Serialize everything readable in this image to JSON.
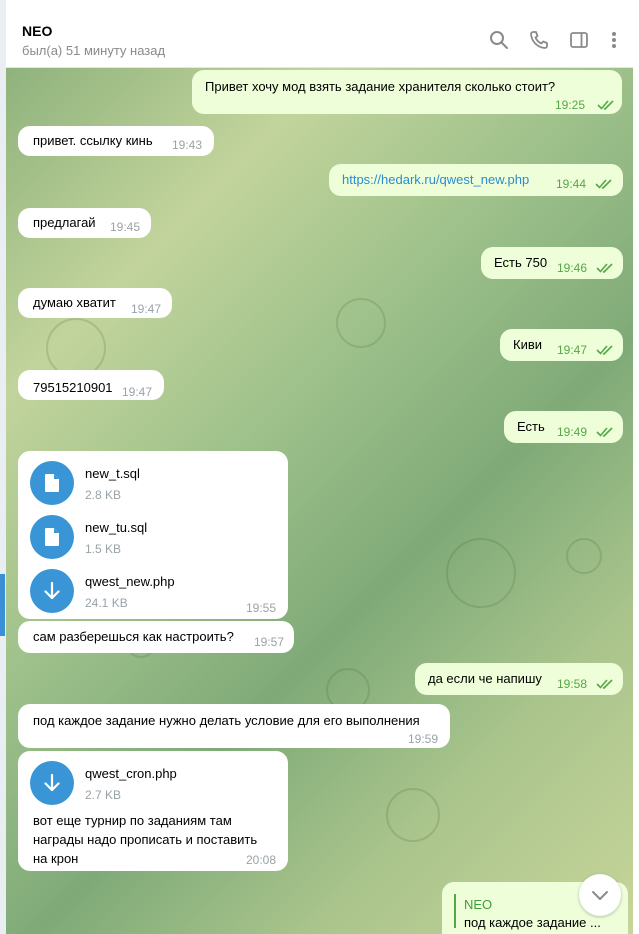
{
  "header": {
    "name": "NEO",
    "status": "был(а) 51 минуту назад",
    "icons": [
      "search-icon",
      "phone-icon",
      "sidebar-toggle-icon",
      "more-vertical-icon"
    ]
  },
  "messages": [
    {
      "dir": "out",
      "text": "Привет хочу мод взять задание хранителя сколько стоит?",
      "time": "19:25"
    },
    {
      "dir": "in",
      "text": "привет. ссылку кинь",
      "time": "19:43"
    },
    {
      "dir": "out",
      "text": "https://hedark.ru/qwest_new.php",
      "time": "19:44"
    },
    {
      "dir": "in",
      "text": "предлагай",
      "time": "19:45"
    },
    {
      "dir": "out",
      "text": "Есть 750",
      "time": "19:46"
    },
    {
      "dir": "in",
      "text": "думаю хватит",
      "time": "19:47"
    },
    {
      "dir": "out",
      "text": "Киви",
      "time": "19:47"
    },
    {
      "dir": "in",
      "text": "79515210901",
      "time": "19:47"
    },
    {
      "dir": "out",
      "text": "Есть",
      "time": "19:49"
    },
    {
      "dir": "in",
      "files": [
        {
          "name": "new_t.sql",
          "size": "2.8 KB",
          "icon": "document-icon"
        },
        {
          "name": "new_tu.sql",
          "size": "1.5 KB",
          "icon": "document-icon"
        },
        {
          "name": "qwest_new.php",
          "size": "24.1 KB",
          "icon": "download-icon"
        }
      ],
      "time": "19:55"
    },
    {
      "dir": "in",
      "text": "сам разберешься как настроить?",
      "time": "19:57"
    },
    {
      "dir": "out",
      "text": "да если че напишу",
      "time": "19:58"
    },
    {
      "dir": "in",
      "text": "под каждое задание нужно делать условие для его выполнения",
      "time": "19:59"
    },
    {
      "dir": "in",
      "files": [
        {
          "name": "qwest_cron.php",
          "size": "2.7 KB",
          "icon": "download-icon"
        }
      ],
      "caption": [
        "вот еще турнир по заданиям там",
        "награды  надо прописать и поставить",
        "на крон"
      ],
      "time": "20:08"
    }
  ],
  "reply_preview": {
    "name": "NEO",
    "text": "под каждое задание ..."
  },
  "colors": {
    "outgoing_bubble": "#eefed8",
    "incoming_bubble": "#ffffff",
    "accent_blue": "#3a95d6",
    "read_green": "#57a748"
  }
}
